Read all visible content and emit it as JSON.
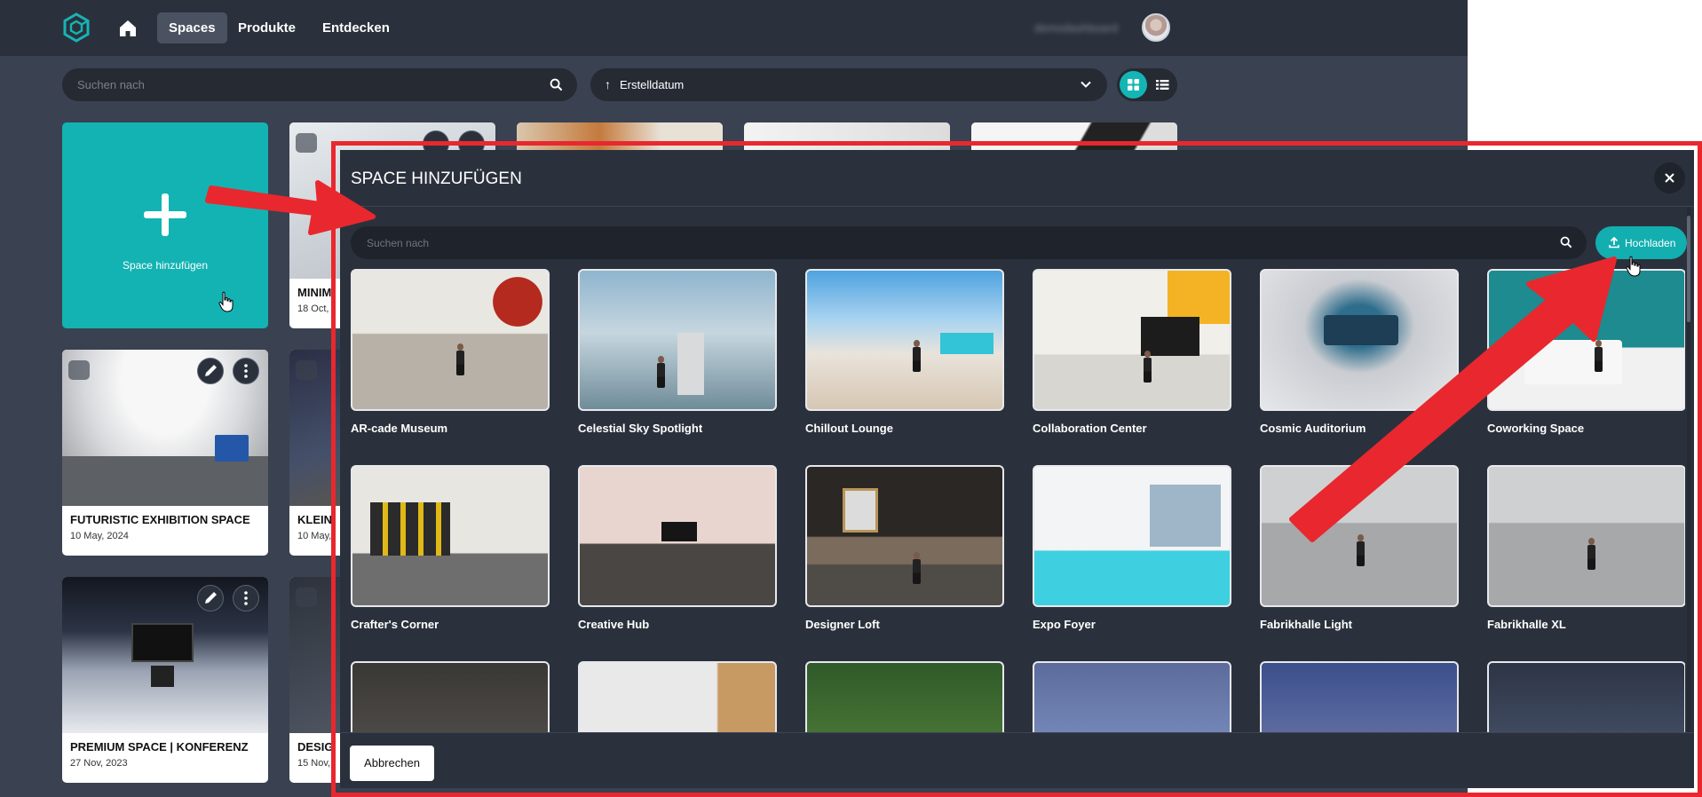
{
  "nav": {
    "items": [
      {
        "label": "Spaces",
        "active": true
      },
      {
        "label": "Produkte",
        "active": false
      },
      {
        "label": "Entdecken",
        "active": false
      }
    ],
    "user_name": "demodashboard"
  },
  "toolbar": {
    "search_placeholder": "Suchen nach",
    "sort_label": "Erstelldatum"
  },
  "add_card": {
    "label": "Space hinzufügen"
  },
  "spaces": [
    {
      "title": "MINIM",
      "date": "18 Oct,"
    },
    {
      "title": "FUTURISTIC EXHIBITION SPACE",
      "date": "10 May, 2024"
    },
    {
      "title": "KLEIN",
      "date": "10 May,"
    },
    {
      "title": "PREMIUM SPACE | KONFERENZ",
      "date": "27 Nov, 2023"
    },
    {
      "title": "DESIG",
      "date": "15 Nov,"
    }
  ],
  "modal": {
    "title": "SPACE HINZUFÜGEN",
    "search_placeholder": "Suchen nach",
    "upload_label": "Hochladen",
    "cancel_label": "Abbrechen",
    "templates": [
      "AR-cade Museum",
      "Celestial Sky Spotlight",
      "Chillout Lounge",
      "Collaboration Center",
      "Cosmic Auditorium",
      "Coworking Space",
      "Crafter's Corner",
      "Creative Hub",
      "Designer Loft",
      "Expo Foyer",
      "Fabrikhalle Light",
      "Fabrikhalle XL",
      "",
      "",
      "",
      "",
      "",
      ""
    ]
  },
  "colors": {
    "accent": "#13b3b3",
    "page_bg": "#3a4150",
    "topbar_bg": "#2b313c",
    "annotation_red": "#e8282e"
  }
}
